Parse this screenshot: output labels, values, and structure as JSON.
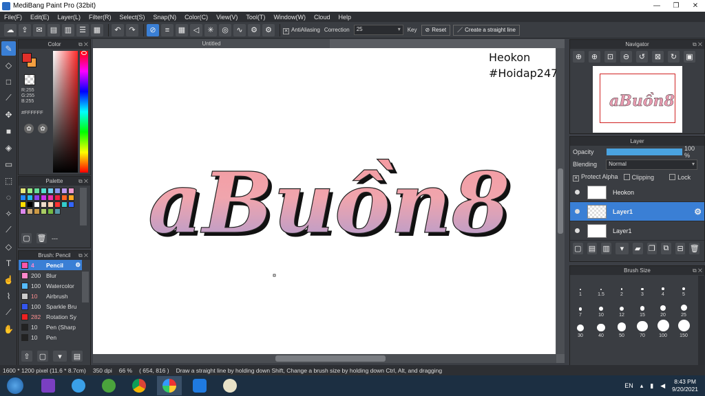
{
  "window": {
    "title": "MediBang Paint Pro (32bit)",
    "min": "—",
    "max": "❐",
    "close": "✕"
  },
  "menu": [
    "File(F)",
    "Edit(E)",
    "Layer(L)",
    "Filter(R)",
    "Select(S)",
    "Snap(N)",
    "Color(C)",
    "View(V)",
    "Tool(T)",
    "Window(W)",
    "Cloud",
    "Help"
  ],
  "toolbar": {
    "antialiasing_label": "AntiAliasing",
    "correction_label": "Correction",
    "correction_value": "25",
    "key_label": "Key",
    "reset_label": "Reset",
    "straight_line_label": "Create a straight line"
  },
  "color_panel": {
    "title": "Color",
    "r": "R:255",
    "g": "G:255",
    "b": "B:255",
    "hex": "#FFFFFF",
    "primary": "#e0302a",
    "secondary": "#f5a040"
  },
  "palette": {
    "title": "Palette",
    "swatches": [
      "#e5e57a",
      "#99ee88",
      "#66dd99",
      "#55ddcc",
      "#77ccee",
      "#8899ee",
      "#bb99ee",
      "#ee99cc",
      "#2288ff",
      "#22bbee",
      "#8844ee",
      "#cc33ee",
      "#ee33aa",
      "#ee2244",
      "#ff6622",
      "#ffaa22",
      "#ffdd00",
      "#000000",
      "#ffffff",
      "#eeddcc",
      "#ffccaa",
      "#ff3333",
      "#33cccc",
      "#3366ff",
      "#dd88ee",
      "#ccaa77",
      "#cc9944",
      "#aacc66",
      "#77bb44",
      "#5599aa"
    ],
    "count": "---"
  },
  "brush_panel": {
    "title": "Brush: Pencil",
    "items": [
      {
        "size": "4",
        "name": "Pencil",
        "color": "#ff55aa"
      },
      {
        "size": "200",
        "name": "Blur",
        "color": "#ff88cc"
      },
      {
        "size": "100",
        "name": "Watercolor",
        "color": "#55bbff"
      },
      {
        "size": "10",
        "name": "Airbrush",
        "color": "#cccccc"
      },
      {
        "size": "100",
        "name": "Sparkle Bru",
        "color": "#3355ee"
      },
      {
        "size": "282",
        "name": "Rotation Sy",
        "color": "#ee2222"
      },
      {
        "size": "10",
        "name": "Pen (Sharp",
        "color": "#222222"
      },
      {
        "size": "10",
        "name": "Pen",
        "color": "#222222"
      }
    ]
  },
  "canvas": {
    "tab": "Untitled",
    "watermark_line1": "Heokon",
    "watermark_line2": "#Hoidap247",
    "art_text": "aBuồn8"
  },
  "navigator": {
    "title": "Navigator"
  },
  "layer_panel": {
    "title": "Layer",
    "opacity_label": "Opacity",
    "opacity_value": "100 %",
    "opacity_fraction": 1.0,
    "blending_label": "Blending",
    "blending_value": "Normal",
    "protect_alpha": "Protect Alpha",
    "clipping": "Clipping",
    "lock": "Lock",
    "layers": [
      {
        "name": "Heokon",
        "selected": false
      },
      {
        "name": "Layer1",
        "selected": true
      },
      {
        "name": "Layer1",
        "selected": false
      }
    ]
  },
  "brush_size": {
    "title": "Brush Size",
    "sizes": [
      "1",
      "1.5",
      "2",
      "3",
      "4",
      "5",
      "7",
      "10",
      "12",
      "15",
      "20",
      "25",
      "30",
      "40",
      "50",
      "70",
      "100",
      "150"
    ]
  },
  "status": {
    "dimensions": "1600 * 1200 pixel",
    "physical": "(11.6 * 8.7cm)",
    "dpi": "350 dpi",
    "zoom": "66 %",
    "coords": "( 654, 816 )",
    "hint": "Draw a straight line by holding down Shift, Change a brush size by holding down Ctrl, Alt, and dragging"
  },
  "taskbar": {
    "lang": "EN",
    "time": "8:43 PM",
    "date": "9/20/2021"
  }
}
